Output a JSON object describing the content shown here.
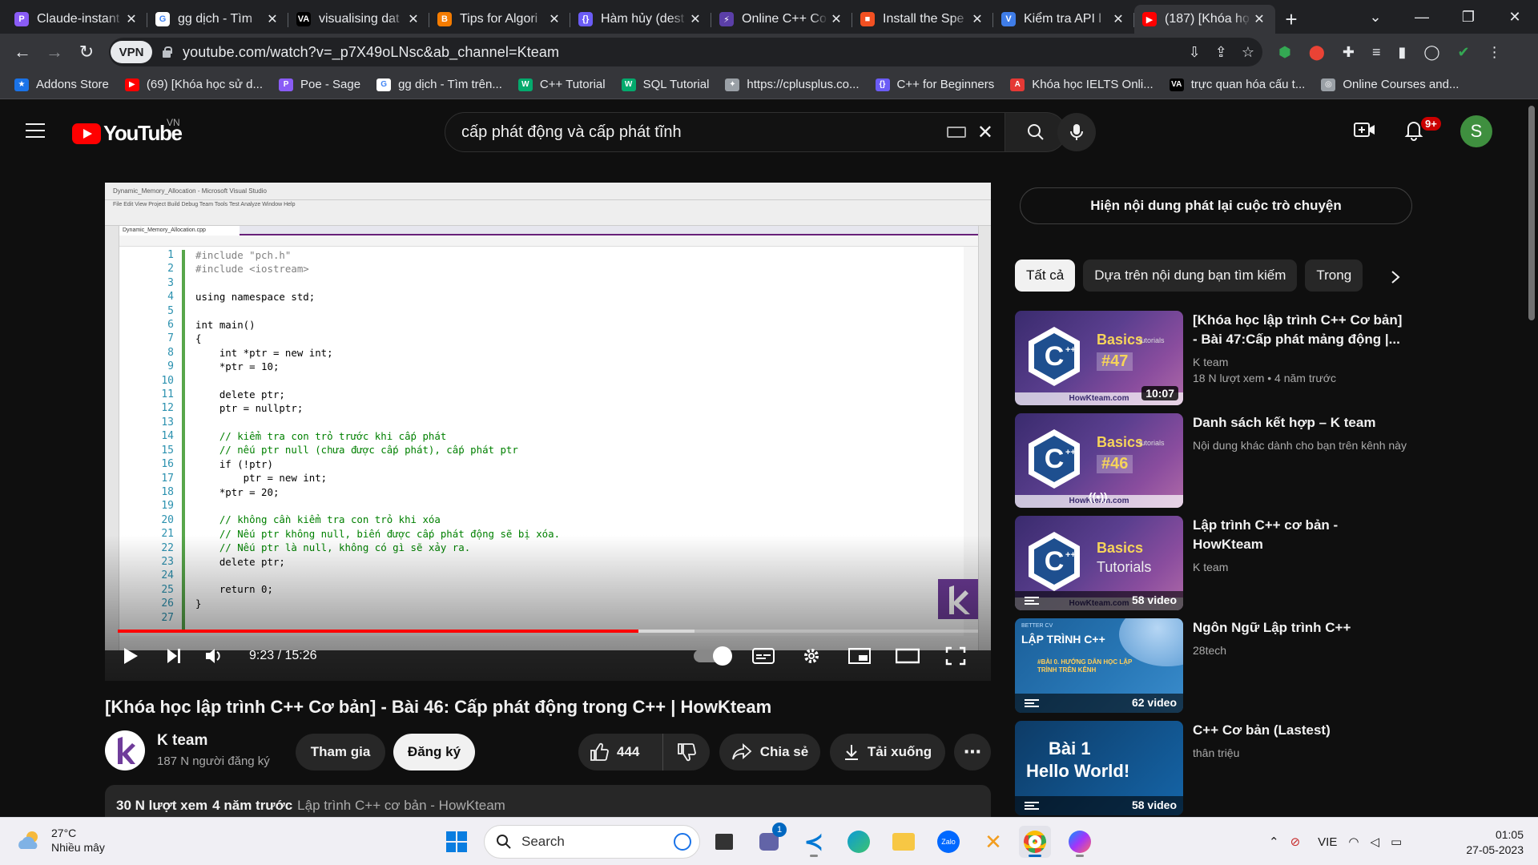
{
  "browser": {
    "tabs": [
      {
        "title": "Claude-instant",
        "favicon": "poe-icon",
        "color": "#8a5cf6",
        "glyph": "P"
      },
      {
        "title": "gg dịch - Tìm",
        "favicon": "google-icon",
        "color": "#ffffff",
        "glyph": "G"
      },
      {
        "title": "visualising dat",
        "favicon": "va-icon",
        "color": "#000000",
        "glyph": "VA"
      },
      {
        "title": "Tips for Algori",
        "favicon": "blogger-icon",
        "color": "#f57c00",
        "glyph": "B"
      },
      {
        "title": "Hàm hủy (dest",
        "favicon": "code-icon",
        "color": "#6b5cf6",
        "glyph": "{}"
      },
      {
        "title": "Online C++ Co",
        "favicon": "bolt-icon",
        "color": "#5b3fa8",
        "glyph": "⚡"
      },
      {
        "title": "Install the Spe",
        "favicon": "microsoft-icon",
        "color": "#f25022",
        "glyph": "■"
      },
      {
        "title": "Kiểm tra API l",
        "favicon": "v-icon",
        "color": "#3f7de8",
        "glyph": "V"
      },
      {
        "title": "(187) [Khóa họ",
        "favicon": "youtube-icon",
        "color": "#ff0000",
        "glyph": "▶",
        "active": true
      }
    ],
    "url": "youtube.com/watch?v=_p7X49oLNsc&ab_channel=Kteam",
    "vpn_label": "VPN",
    "bookmarks": [
      {
        "label": "Addons Store",
        "icon": "addons-icon",
        "color": "#1a73e8",
        "glyph": "★"
      },
      {
        "label": "(69) [Khóa học sử d...",
        "icon": "youtube-icon",
        "color": "#ff0000",
        "glyph": "▶"
      },
      {
        "label": "Poe - Sage",
        "icon": "poe-icon",
        "color": "#8a5cf6",
        "glyph": "P"
      },
      {
        "label": "gg dịch - Tìm trên...",
        "icon": "google-icon",
        "color": "#ffffff",
        "glyph": "G"
      },
      {
        "label": "C++ Tutorial",
        "icon": "w3-icon",
        "color": "#04aa6d",
        "glyph": "W"
      },
      {
        "label": "SQL Tutorial",
        "icon": "w3-icon",
        "color": "#04aa6d",
        "glyph": "W"
      },
      {
        "label": "https://cplusplus.co...",
        "icon": "cplusplus-icon",
        "color": "#9aa0a6",
        "glyph": "✦"
      },
      {
        "label": "C++ for Beginners",
        "icon": "code-icon",
        "color": "#6b5cf6",
        "glyph": "{}"
      },
      {
        "label": "Khóa học IELTS Onli...",
        "icon": "ielts-icon",
        "color": "#e53935",
        "glyph": "A"
      },
      {
        "label": "trực quan hóa cấu t...",
        "icon": "va-icon",
        "color": "#000000",
        "glyph": "VA"
      },
      {
        "label": "Online Courses and...",
        "icon": "courses-icon",
        "color": "#9aa0a6",
        "glyph": "◎"
      }
    ]
  },
  "youtube": {
    "logo_text": "YouTube",
    "country": "VN",
    "search_query": "cấp phát động và cấp phát tĩnh",
    "notif_count": "9+",
    "avatar_letter": "S"
  },
  "player": {
    "vs_window_title": "Dynamic_Memory_Allocation - Microsoft Visual Studio",
    "vs_menu": "File  Edit  View  Project  Build  Debug  Team  Tools  Test  Analyze  Window  Help",
    "vs_file_tab": "Dynamic_Memory_Allocation.cpp",
    "line_numbers": [
      "1",
      "2",
      "3",
      "4",
      "5",
      "6",
      "7",
      "8",
      "9",
      "10",
      "11",
      "12",
      "13",
      "14",
      "15",
      "16",
      "17",
      "18",
      "19",
      "20",
      "21",
      "22",
      "23",
      "24",
      "25",
      "26",
      "27"
    ],
    "code_lines": [
      "#include \"pch.h\"",
      "#include <iostream>",
      "",
      "using namespace std;",
      "",
      "int main()",
      "{",
      "    int *ptr = new int;",
      "    *ptr = 10;",
      "",
      "    delete ptr;",
      "    ptr = nullptr;",
      "",
      "    // kiểm tra con trỏ trước khi cấp phát",
      "    // nếu ptr null (chưa được cấp phát), cấp phát ptr",
      "    if (!ptr)",
      "        ptr = new int;",
      "    *ptr = 20;",
      "",
      "    // không cần kiểm tra con trỏ khi xóa",
      "    // Nếu ptr không null, biến được cấp phát động sẽ bị xóa.",
      "    // Nếu ptr là null, không có gì sẽ xảy ra.",
      "    delete ptr;",
      "",
      "    return 0;",
      "}",
      ""
    ],
    "current_time": "9:23",
    "duration": "15:26",
    "progress_fraction": 0.605,
    "buffered_fraction": 0.67
  },
  "video": {
    "title": "[Khóa học lập trình C++ Cơ bản] - Bài 46: Cấp phát động trong C++ | HowKteam",
    "channel": "K team",
    "subscribers": "187 N người đăng ký",
    "join_label": "Tham gia",
    "subscribe_label": "Đăng ký",
    "likes": "444",
    "share_label": "Chia sẻ",
    "download_label": "Tải xuống",
    "views": "30 N lượt xem",
    "age": "4 năm trước",
    "playlist": "Lập trình C++ cơ bản - HowKteam"
  },
  "sidebar": {
    "chat_replay_label": "Hiện nội dung phát lại cuộc trò chuyện",
    "chips": [
      "Tất cả",
      "Dựa trên nội dung bạn tìm kiếm",
      "Trong"
    ],
    "recommendations": [
      {
        "title": "[Khóa học lập trình C++ Cơ bản] - Bài 47:Cấp phát mảng động |...",
        "channel": "K team",
        "meta": "18 N lượt xem  • 4 năm trước",
        "badge": "10:07",
        "thumb_num": "#47",
        "thumb_kind": "basics"
      },
      {
        "title": "Danh sách kết hợp – K team",
        "channel": "Nội dung khác dành cho bạn trên kênh này",
        "meta": "",
        "badge": "",
        "thumb_num": "#46",
        "thumb_kind": "mix"
      },
      {
        "title": "Lập trình C++ cơ bản - HowKteam",
        "channel": "K team",
        "meta": "",
        "badge": "58 video",
        "thumb_num": "",
        "thumb_kind": "playlist"
      },
      {
        "title": "Ngôn Ngữ Lập trình C++",
        "channel": "28tech",
        "meta": "",
        "badge": "62 video",
        "thumb_num": "",
        "thumb_kind": "tech"
      },
      {
        "title": "C++ Cơ bản (Lastest)",
        "channel": "thân triệu",
        "meta": "",
        "badge": "58 video",
        "thumb_num": "",
        "thumb_kind": "hello"
      }
    ],
    "thumb_text": {
      "basics": "Basics",
      "tutorials_small": "tutorials",
      "tutorials": "Tutorials",
      "site": "HowKteam.com",
      "tech_top": "BETTER CV",
      "tech_title": "LẬP TRÌNH C++",
      "tech_sub": "#BÀI 0. HƯỚNG DẪN HỌC LẬP TRÌNH TRÊN KÊNH",
      "hello_1": "Bài 1",
      "hello_2": "Hello World!"
    }
  },
  "taskbar": {
    "temperature": "27°C",
    "weather": "Nhiều mây",
    "search_label": "Search",
    "language": "VIE",
    "time": "01:05",
    "date": "27-05-2023",
    "teams_badge": "1"
  }
}
